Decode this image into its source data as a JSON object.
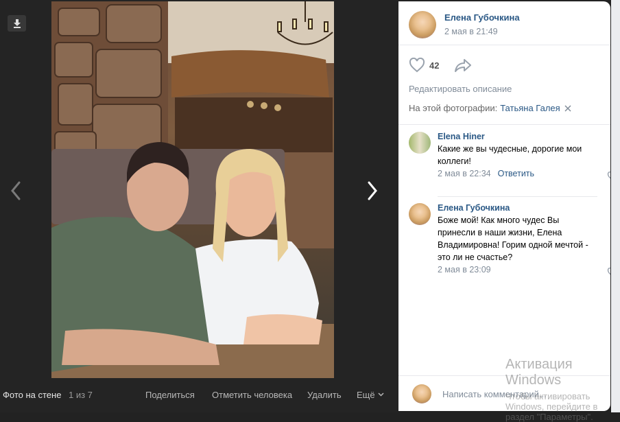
{
  "viewer": {
    "footer": {
      "title": "Фото на стене",
      "counter": "1 из 7",
      "share": "Поделиться",
      "tag_person": "Отметить человека",
      "delete": "Удалить",
      "more": "Ещё"
    }
  },
  "panel": {
    "author": {
      "name": "Елена Губочкина",
      "date": "2 мая в 21:49"
    },
    "likes": "42",
    "edit_description": "Редактировать описание",
    "on_photo_label": "На этой фотографии:",
    "tagged_person": "Татьяна Галея",
    "comments": [
      {
        "name": "Elena Hiner",
        "text": "Какие же вы чудесные, дорогие мои коллеги!",
        "date": "2 мая в 22:34",
        "reply": "Ответить"
      },
      {
        "name": "Елена Губочкина",
        "text": "Боже мой! Как много чудес Вы принесли в наши жизни, Елена Владимировна! Горим одной мечтой - это ли не счастье?",
        "date": "2 мая в 23:09"
      }
    ],
    "write_placeholder": "Написать комментарий..."
  },
  "watermark": {
    "title": "Активация Windows",
    "subtitle": "Чтобы активировать Windows, перейдите в раздел \"Параметры\"."
  },
  "colors": {
    "link": "#2a5885",
    "muted": "#818c99",
    "viewer_bg": "#242424"
  },
  "icons": [
    "download-icon",
    "chevron-left-icon",
    "chevron-right-icon",
    "heart-icon",
    "share-arrow-icon",
    "close-icon",
    "chevron-down-icon"
  ]
}
